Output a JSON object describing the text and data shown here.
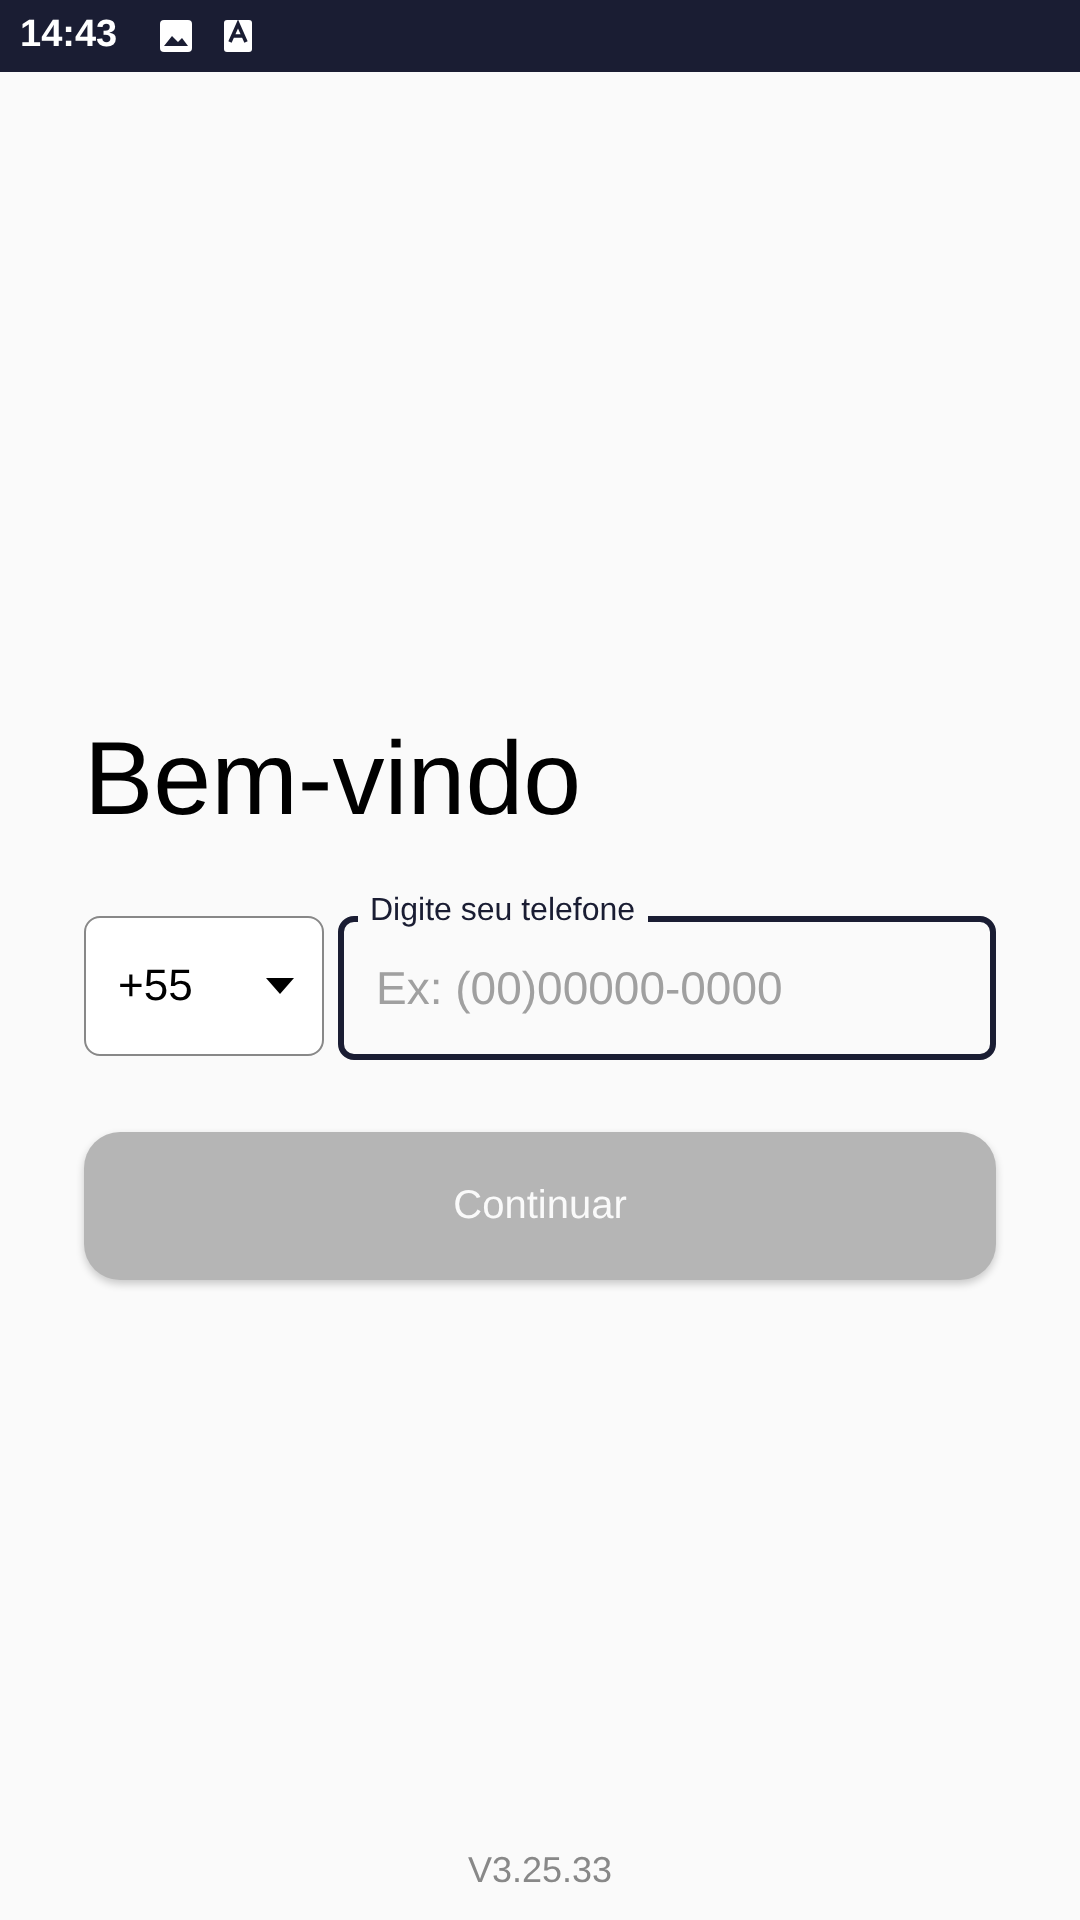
{
  "status_bar": {
    "time": "14:43"
  },
  "title": "Bem-vindo",
  "country_code": {
    "value": "+55"
  },
  "phone_field": {
    "label": "Digite seu telefone",
    "placeholder": "Ex: (00)00000-0000",
    "focused": true
  },
  "continue_button": {
    "label": "Continuar",
    "disabled": true
  },
  "version": "V3.25.33"
}
